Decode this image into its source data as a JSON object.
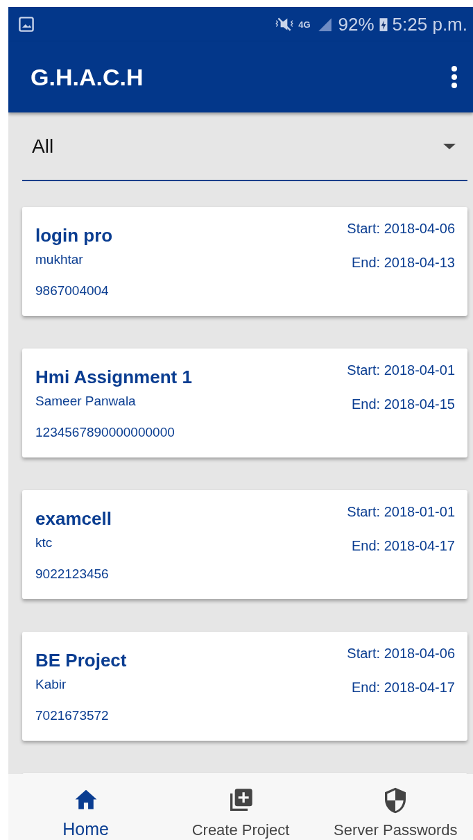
{
  "status_bar": {
    "battery": "92%",
    "time": "5:25 p.m.",
    "network": "4G"
  },
  "app_bar": {
    "title": "G.H.A.C.H"
  },
  "filter": {
    "value": "All"
  },
  "projects": [
    {
      "name": "login pro",
      "owner": "mukhtar",
      "phone": "9867004004",
      "start": "Start: 2018-04-06",
      "end": "End: 2018-04-13"
    },
    {
      "name": "Hmi Assignment 1",
      "owner": "Sameer Panwala",
      "phone": "1234567890000000000",
      "start": "Start: 2018-04-01",
      "end": "End: 2018-04-15"
    },
    {
      "name": "examcell",
      "owner": "ktc",
      "phone": "9022123456",
      "start": "Start: 2018-01-01",
      "end": "End: 2018-04-17"
    },
    {
      "name": "BE Project",
      "owner": "Kabir",
      "phone": "7021673572",
      "start": "Start: 2018-04-06",
      "end": "End: 2018-04-17"
    }
  ],
  "bottom_nav": [
    {
      "label": "Home",
      "kind": "home",
      "selected": true
    },
    {
      "label": "Create Project",
      "kind": "create",
      "selected": false
    },
    {
      "label": "Server Passwords",
      "kind": "shield",
      "selected": false
    }
  ]
}
